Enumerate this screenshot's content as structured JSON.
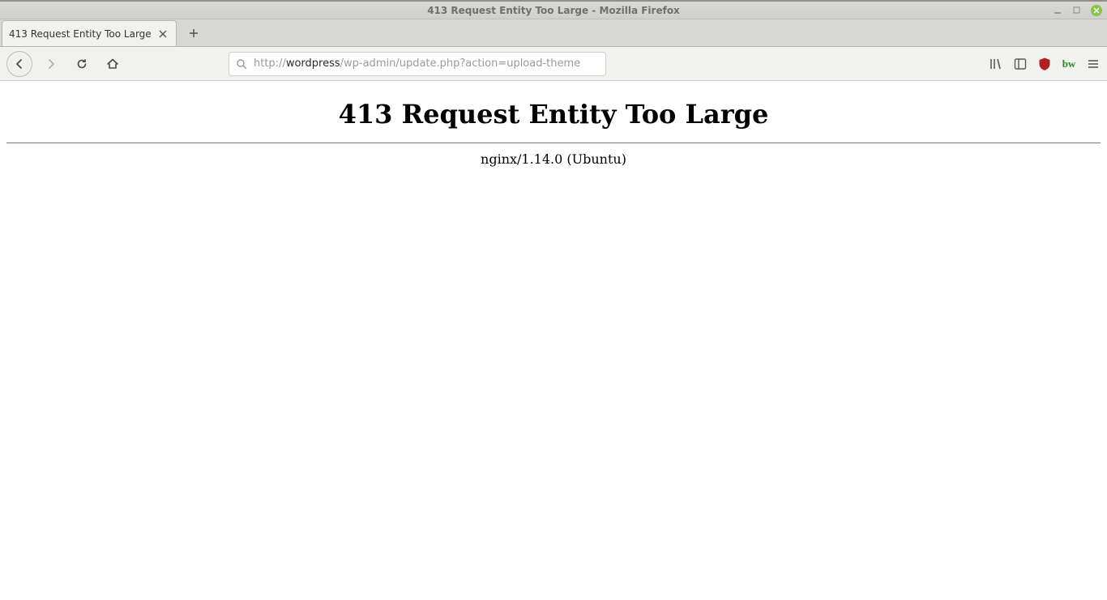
{
  "window": {
    "title": "413 Request Entity Too Large - Mozilla Firefox"
  },
  "tab": {
    "title": "413 Request Entity Too Large"
  },
  "url": {
    "protocol": "http://",
    "host": "wordpress",
    "path": "/wp-admin/update.php?action=upload-theme"
  },
  "content": {
    "heading": "413 Request Entity Too Large",
    "server": "nginx/1.14.0 (Ubuntu)"
  }
}
